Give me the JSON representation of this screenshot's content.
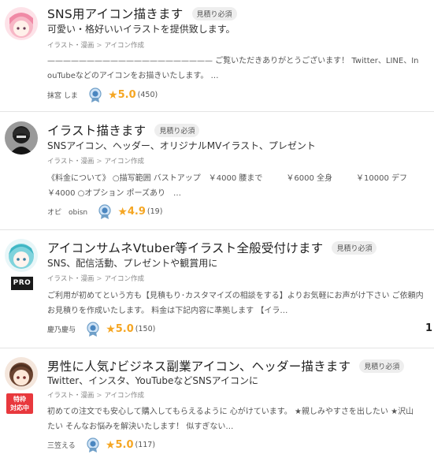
{
  "listings": [
    {
      "title": "SNS用アイコン描きます",
      "tag": "見積り必須",
      "subtitle": "可愛い・格好いいイラストを提供致します。",
      "category": [
        "イラスト・漫画",
        "アイコン作成"
      ],
      "description_lines": [
        "————————————————————— ご覧いただきありがとうございます！ Twitter、LINE、In",
        "ouTubeなどのアイコンをお描きいたします。 …"
      ],
      "seller": "抹宮 しま",
      "rating": "5.0",
      "review_count": "(450)"
    },
    {
      "title": "イラスト描きます",
      "tag": "見積り必須",
      "subtitle": "SNSアイコン、ヘッダー、オリジナルMVイラスト、プレゼント",
      "category": [
        "イラスト・漫画",
        "アイコン作成"
      ],
      "description_lines": [
        "《料金について》 ○描写範囲 バストアップ　￥4000 腰まで　　　￥6000 全身　　　￥10000 デフ",
        "￥4000 ○オプション ポーズあり　…"
      ],
      "seller": "オピ　obisn",
      "rating": "4.9",
      "review_count": "(19)"
    },
    {
      "title": "アイコンサムネVtuber等イラスト全般受付けます",
      "tag": "見積り必須",
      "subtitle": "SNS、配信活動、プレゼントや観賞用に",
      "category": [
        "イラスト・漫画",
        "アイコン作成"
      ],
      "badge": "PRO",
      "description_lines": [
        "ご利用が初めてという方も【見積もり･カスタマイズの相談をする】よりお気軽にお声がけ下さい ご依頼内",
        "お見積りを作成いたします。 料金は下記内容に準拠します 【イラ…"
      ],
      "seller": "慶乃慶与",
      "rating": "5.0",
      "review_count": "(150)",
      "edge_text": "1"
    },
    {
      "title": "男性に人気♪ビジネス副業アイコン、ヘッダー描きます",
      "tag": "見積り必須",
      "subtitle": "Twitter、インスタ、YouTubeなどSNSアイコンに",
      "category": [
        "イラスト・漫画",
        "アイコン作成"
      ],
      "badge": "特枠\n対応中",
      "description_lines": [
        "初めての注文でも安心して購入してもらえるように 心がけています。 ★親しみやすさを出したい ★沢山",
        "たい そんなお悩みを解決いたします！ 似すぎない…"
      ],
      "seller": "三笠える",
      "rating": "5.0",
      "review_count": "(117)"
    }
  ],
  "colors": {
    "accent_star": "#f5a623",
    "pill_bg": "#eeeeee",
    "pro_badge": "#1a1a1a",
    "special_badge": "#e8383d"
  }
}
